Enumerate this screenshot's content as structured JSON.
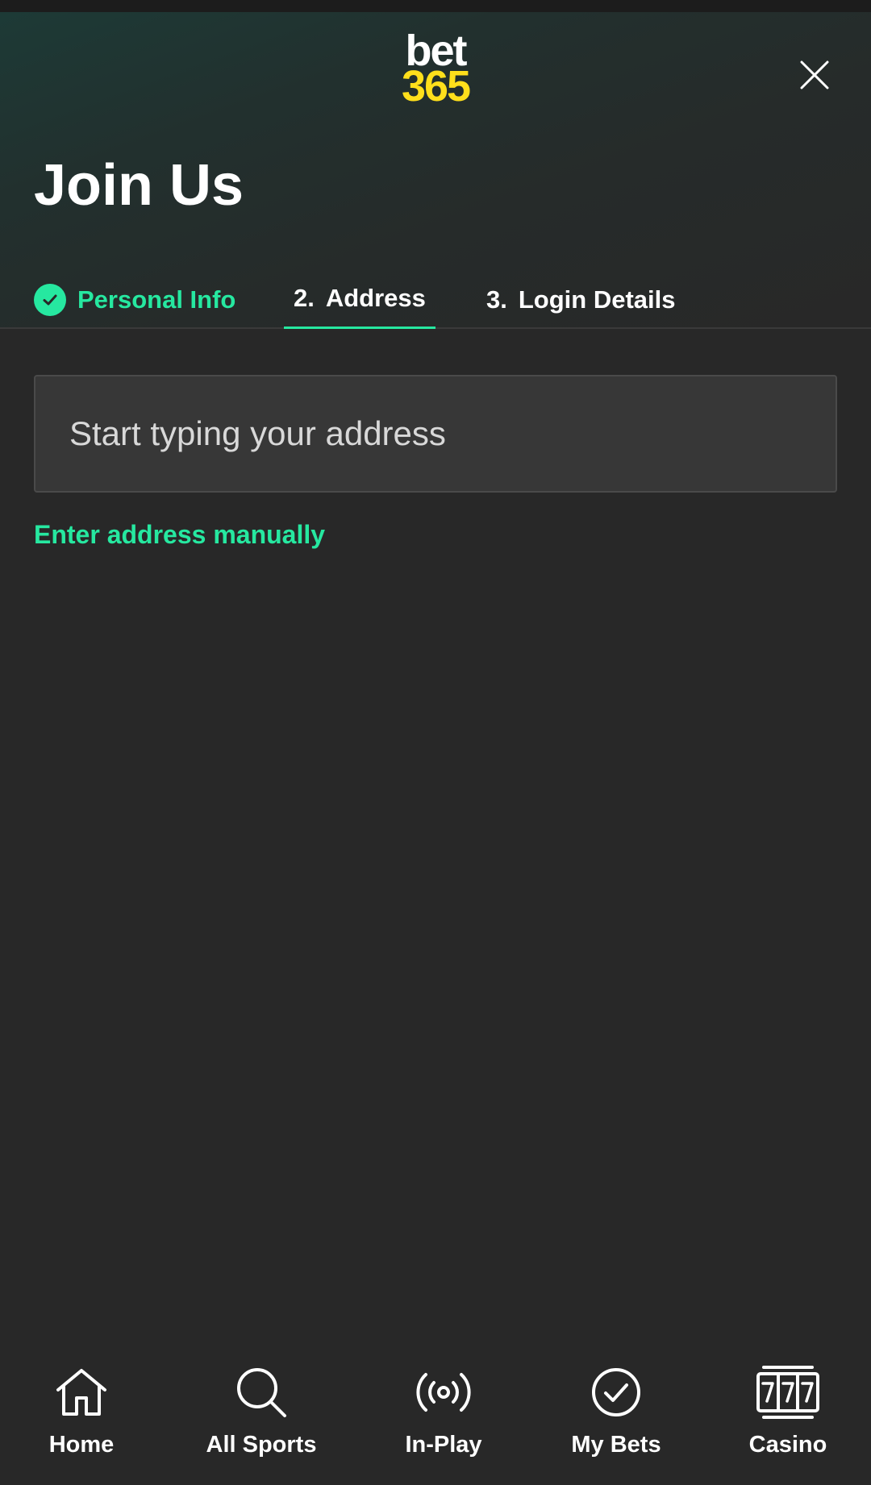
{
  "header": {
    "logo_line1": "bet",
    "logo_line2": "365",
    "title": "Join Us",
    "close_icon": "close-icon"
  },
  "steps": [
    {
      "number": "",
      "label": "Personal Info",
      "state": "completed",
      "icon": "check-circle-icon"
    },
    {
      "number": "2.",
      "label": "Address",
      "state": "active"
    },
    {
      "number": "3.",
      "label": "Login Details",
      "state": "upcoming"
    }
  ],
  "address": {
    "placeholder": "Start typing your address",
    "value": "",
    "manual_link": "Enter address manually"
  },
  "bottom_nav": [
    {
      "label": "Home",
      "icon": "home-icon"
    },
    {
      "label": "All Sports",
      "icon": "search-icon"
    },
    {
      "label": "In-Play",
      "icon": "broadcast-icon"
    },
    {
      "label": "My Bets",
      "icon": "check-circle-icon"
    },
    {
      "label": "Casino",
      "icon": "slot-machine-icon"
    }
  ],
  "colors": {
    "accent": "#26e8a0",
    "logo_yellow": "#ffdf1b",
    "background": "#282828",
    "input_background": "#373737"
  }
}
